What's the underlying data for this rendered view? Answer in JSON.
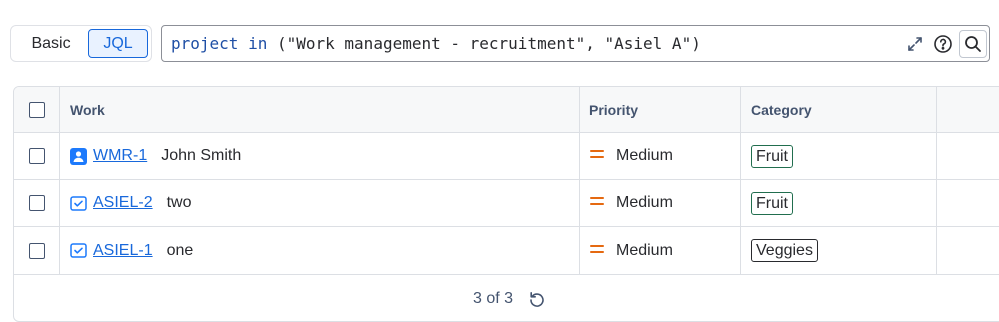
{
  "toggle": {
    "basic_label": "Basic",
    "jql_label": "JQL"
  },
  "jql": {
    "keyword_project": "project",
    "keyword_in": "in",
    "value": "(\"Work management - recruitment\", \"Asiel A\")"
  },
  "table": {
    "headers": {
      "work": "Work",
      "priority": "Priority",
      "category": "Category"
    },
    "rows": [
      {
        "key": "WMR-1",
        "summary": "John Smith",
        "type_icon": "user-story-icon",
        "priority": "Medium",
        "category": "Fruit",
        "category_color": "#216e4e"
      },
      {
        "key": "ASIEL-2",
        "summary": "two",
        "type_icon": "task-icon",
        "priority": "Medium",
        "category": "Fruit",
        "category_color": "#216e4e"
      },
      {
        "key": "ASIEL-1",
        "summary": "one",
        "type_icon": "task-icon",
        "priority": "Medium",
        "category": "Veggies",
        "category_color": "#292a2e"
      }
    ]
  },
  "footer": {
    "count": "3 of 3"
  },
  "colors": {
    "accent": "#1868db",
    "priority_medium": "#e56910"
  }
}
